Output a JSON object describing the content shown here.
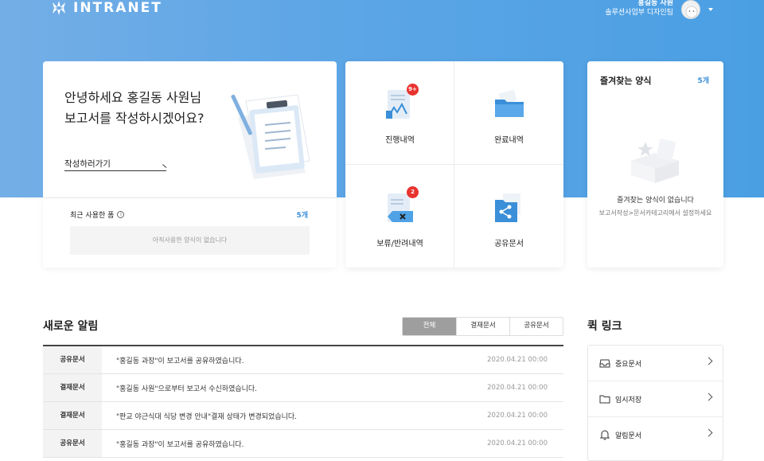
{
  "header": {
    "logo_text": "INTRANET",
    "user_name": "홍길동 사원",
    "user_dept": "솔루션사업부 디자인팀"
  },
  "welcome": {
    "line1": "안녕하세요 홍길동 사원님",
    "line2": "보고서를 작성하시겠어요?",
    "link": "작성하러가기"
  },
  "recent": {
    "title": "최근 사용한 폼",
    "info_icon": "info-icon",
    "count": "5개",
    "empty": "아직사용한 양식이 없습니다"
  },
  "tiles": [
    {
      "label": "진행내역",
      "badge": "9+"
    },
    {
      "label": "완료내역",
      "badge": ""
    },
    {
      "label": "보류/반려내역",
      "badge": "2"
    },
    {
      "label": "공유문서",
      "badge": ""
    }
  ],
  "favorites": {
    "title": "즐겨찾는 양식",
    "count": "5개",
    "empty": "즐겨찾는 양식이 없습니다",
    "hint": "보고서작성>문서카테고리에서 설정하세요"
  },
  "notifications": {
    "title": "새로운 알림",
    "tabs": [
      "전체",
      "결재문서",
      "공유문서"
    ],
    "active_tab": "전체",
    "rows": [
      {
        "category": "공유문서",
        "message": "\"홍길동 과장\"이 보고서를 공유하였습니다.",
        "date": "2020.04.21 00:00"
      },
      {
        "category": "결재문서",
        "message": "\"홍길동 사원\"으로부터 보고서 수신하였습니다.",
        "date": "2020.04.21 00:00"
      },
      {
        "category": "결재문서",
        "message": "\"판교 야근식대 식당 변경 안내\"결재 상태가 변경되었습니다.",
        "date": "2020.04.21 00:00"
      },
      {
        "category": "공유문서",
        "message": "\"홍길동 과장\"이 보고서를 공유하였습니다.",
        "date": "2020.04.21 00:00"
      }
    ]
  },
  "quick_links": {
    "title": "퀵 링크",
    "items": [
      {
        "label": "중요문서",
        "icon": "inbox-icon"
      },
      {
        "label": "임시저장",
        "icon": "folder-icon"
      },
      {
        "label": "알림문서",
        "icon": "bell-icon"
      }
    ]
  },
  "colors": {
    "header_blue": "#5ea6e6",
    "accent_blue": "#3a8fd8",
    "badge_red": "#e8332f",
    "active_tab_gray": "#9e9e9e"
  }
}
